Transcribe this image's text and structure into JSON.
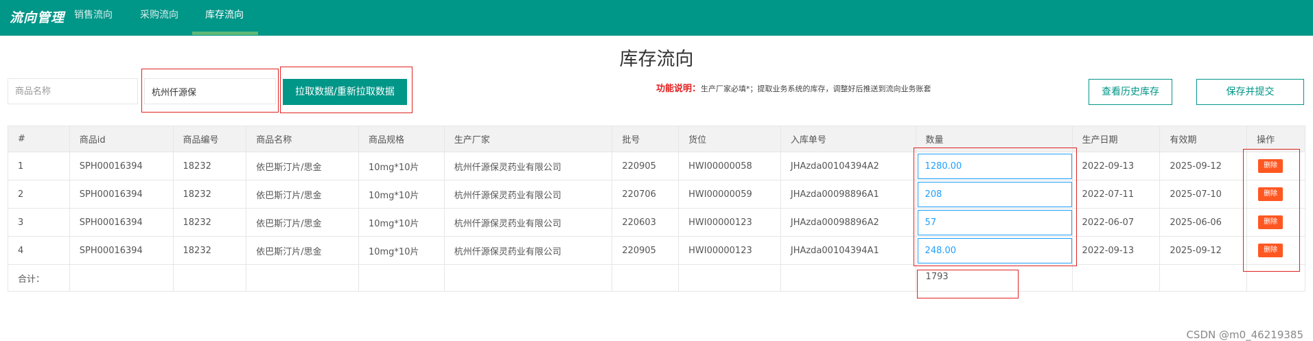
{
  "nav": {
    "brand": "流向管理",
    "items": [
      {
        "label": "销售流向",
        "active": false
      },
      {
        "label": "采购流向",
        "active": false
      },
      {
        "label": "库存流向",
        "active": true
      }
    ]
  },
  "page_title": "库存流向",
  "toolbar": {
    "product_name_placeholder": "商品名称",
    "manufacturer_value": "杭州仟源保",
    "fetch_button": "拉取数据/重新拉取数据",
    "function_note_label": "功能说明：",
    "function_note_text": "生产厂家必填*；提取业务系统的库存，调整好后推送到流向业务账套",
    "history_button": "查看历史库存",
    "save_submit_button": "保存并提交"
  },
  "table": {
    "headers": [
      "#",
      "商品id",
      "商品编号",
      "商品名称",
      "商品规格",
      "生产厂家",
      "批号",
      "货位",
      "入库单号",
      "数量",
      "生产日期",
      "有效期",
      "操作"
    ],
    "rows": [
      {
        "no": "1",
        "id": "SPH00016394",
        "code": "18232",
        "name": "依巴斯汀片/思金",
        "spec": "10mg*10片",
        "maker": "杭州仟源保灵药业有限公司",
        "batch": "220905",
        "location": "HWI00000058",
        "order": "JHAzda00104394A2",
        "qty": "1280.00",
        "mfg": "2022-09-13",
        "exp": "2025-09-12"
      },
      {
        "no": "2",
        "id": "SPH00016394",
        "code": "18232",
        "name": "依巴斯汀片/思金",
        "spec": "10mg*10片",
        "maker": "杭州仟源保灵药业有限公司",
        "batch": "220706",
        "location": "HWI00000059",
        "order": "JHAzda00098896A1",
        "qty": "208",
        "mfg": "2022-07-11",
        "exp": "2025-07-10"
      },
      {
        "no": "3",
        "id": "SPH00016394",
        "code": "18232",
        "name": "依巴斯汀片/思金",
        "spec": "10mg*10片",
        "maker": "杭州仟源保灵药业有限公司",
        "batch": "220603",
        "location": "HWI00000123",
        "order": "JHAzda00098896A2",
        "qty": "57",
        "mfg": "2022-06-07",
        "exp": "2025-06-06"
      },
      {
        "no": "4",
        "id": "SPH00016394",
        "code": "18232",
        "name": "依巴斯汀片/思金",
        "spec": "10mg*10片",
        "maker": "杭州仟源保灵药业有限公司",
        "batch": "220905",
        "location": "HWI00000123",
        "order": "JHAzda00104394A1",
        "qty": "248.00",
        "mfg": "2022-09-13",
        "exp": "2025-09-12"
      }
    ],
    "delete_label": "删除",
    "sum_label": "合计：",
    "sum_value": "1793"
  },
  "watermark": "CSDN @m0_46219385",
  "colors": {
    "primary": "#009688",
    "nav_active_bar": "#5FB878",
    "qty_border": "#1E9FFF",
    "delete_button": "#FF5722",
    "annotation_red": "#e02020"
  }
}
